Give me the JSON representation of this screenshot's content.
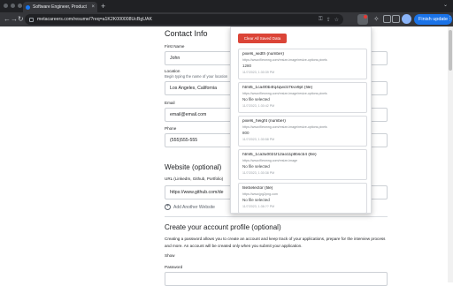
{
  "browser": {
    "tab_title": "Software Engineer, Product",
    "tab_close": "×",
    "new_tab": "+",
    "url": "metacareers.com/resume/?req=a1K2K000008UcBgUAK",
    "finish_update": "Finish update",
    "back": "←",
    "forward": "→",
    "reload": "↻",
    "caret": "⌄",
    "kebab": "⋮",
    "puzzle": "✧"
  },
  "form": {
    "contact_title": "Contact Info",
    "first_name_label": "First Name",
    "first_name_value": "John",
    "location_label": "Location",
    "location_hint": "Begin typing the name of your location",
    "location_value": "Los Angeles, California",
    "email_label": "Email",
    "email_value": "email@email.com",
    "phone_label": "Phone",
    "phone_value": "(555)555-555",
    "website_title": "Website (optional)",
    "url_label": "URL (LinkedIn, Github, Portfolio)",
    "url_value": "https://www.github.com/de",
    "add_website": "Add Another Website",
    "account_title": "Create your account profile (optional)",
    "account_text": "Creating a password allows you to create an account and keep track of your applications, prepare for the interview process and more. An account will be created only when you submit your application.",
    "show_label": "Show",
    "password_label": "Password"
  },
  "popup": {
    "clear_button": "Clear All Saved Data",
    "entries": [
      {
        "name": "pixels_width (number)",
        "url": "https://www.filesmng.com/resize-image/resize-options.pixels",
        "value": "1280",
        "time": "11/7/2023, 1:30:39 PM"
      },
      {
        "name": "html5_1ca4f0b4fq4qwcb7kvv9pt (file)",
        "url": "https://www.filesmng.com/resize-image/resize-options.pixels",
        "value": "No file selected",
        "time": "11/7/2023, 1:30:42 PM"
      },
      {
        "name": "pixels_height (number)",
        "url": "https://www.filesmng.com/resize-image/resize-options.pixels",
        "value": "800",
        "time": "11/7/2023, 1:30:58 PM"
      },
      {
        "name": "html5_1ca3u0021f12ao11ptlbscb4 (file)",
        "url": "https://www.filesmng.com/resize-image",
        "value": "No file selected",
        "time": "11/7/2023, 1:30:38 PM"
      },
      {
        "name": "fileSelector (file)",
        "url": "https://www.jpg2png.com",
        "value": "No file selected",
        "time": "11/7/2023, 1:36:?? PM"
      }
    ]
  },
  "colors": {
    "accent": "#1a73e8",
    "clear_button": "#db4437",
    "chrome_dark": "#202124"
  }
}
